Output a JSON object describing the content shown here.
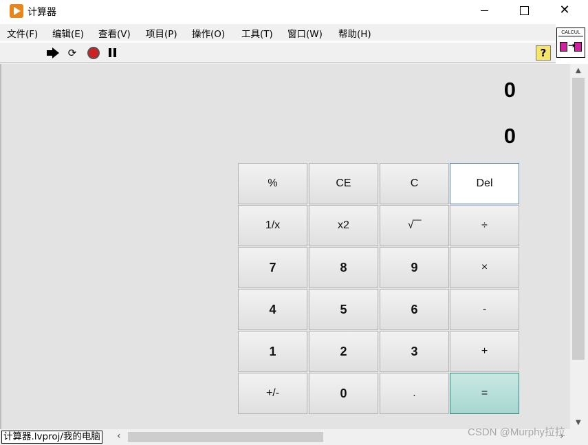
{
  "window": {
    "title": "计算器"
  },
  "menu": [
    "文件(F)",
    "编辑(E)",
    "查看(V)",
    "项目(P)",
    "操作(O)",
    "工具(T)",
    "窗口(W)",
    "帮助(H)"
  ],
  "toolbar": {
    "icons": [
      "run-arrow",
      "run-continuously",
      "abort-execution",
      "pause",
      "context-help"
    ],
    "help_label": "?"
  },
  "vi_icon": {
    "label": "CALCUL",
    "arrow": "→"
  },
  "display": {
    "top": "0",
    "bottom": "0"
  },
  "keypad": [
    [
      "%",
      "CE",
      "C",
      "Del"
    ],
    [
      "1/x",
      "x2",
      "√‾‾",
      "÷"
    ],
    [
      "7",
      "8",
      "9",
      "×"
    ],
    [
      "4",
      "5",
      "6",
      "-"
    ],
    [
      "1",
      "2",
      "3",
      "+"
    ],
    [
      "+/-",
      "0",
      ".",
      "="
    ]
  ],
  "status": {
    "path": "计算器.lvproj/我的电脑"
  },
  "watermark": "CSDN @Murphy拉拉",
  "colors": {
    "equals_key": "#a8d6d0",
    "del_key_border": "#5b86b8",
    "app_icon": "#e8861c",
    "abort": "#cc2222"
  }
}
